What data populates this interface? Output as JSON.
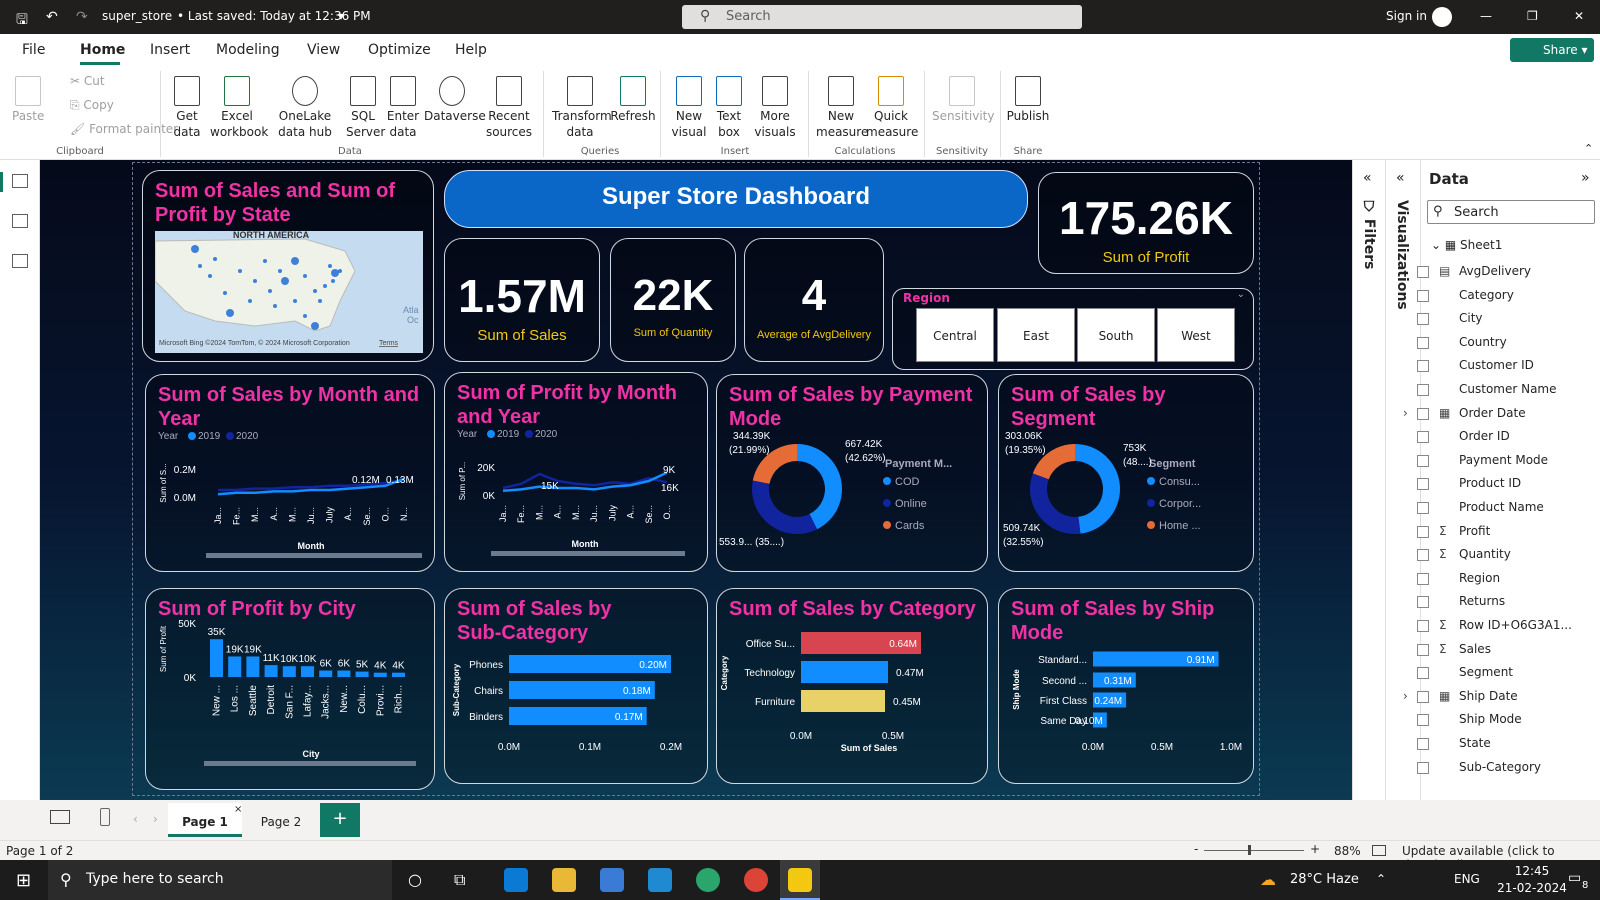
{
  "titlebar": {
    "filename": "super_store",
    "saved": "• Last saved: Today at 12:36 PM",
    "search_placeholder": "Search",
    "signin": "Sign in"
  },
  "menu": {
    "items": [
      "File",
      "Home",
      "Insert",
      "Modeling",
      "View",
      "Optimize",
      "Help"
    ],
    "share": "Share"
  },
  "ribbon": {
    "clipboard": {
      "paste": "Paste",
      "cut": "Cut",
      "copy": "Copy",
      "format_painter": "Format painter",
      "group": "Clipboard"
    },
    "data": {
      "get_data": "Get data",
      "excel": "Excel workbook",
      "onelake": "OneLake data hub",
      "sql": "SQL Server",
      "enter": "Enter data",
      "dataverse": "Dataverse",
      "recent": "Recent sources",
      "group": "Data"
    },
    "queries": {
      "transform": "Transform data",
      "refresh": "Refresh",
      "group": "Queries"
    },
    "insert": {
      "new_visual": "New visual",
      "text_box": "Text box",
      "more_visuals": "More visuals",
      "group": "Insert"
    },
    "calculations": {
      "new_measure": "New measure",
      "quick_measure": "Quick measure",
      "group": "Calculations"
    },
    "sensitivity": {
      "label": "Sensitivity",
      "group": "Sensitivity"
    },
    "share": {
      "publish": "Publish",
      "group": "Share"
    }
  },
  "dashboard": {
    "header": "Super Store Dashboard",
    "map": {
      "title": "Sum of Sales and Sum of Profit by State",
      "region": "NORTH AMERICA",
      "atlantic": "Atla",
      "ocean": "Oc",
      "credit": "Microsoft Bing  ©2024 TomTom, © 2024 Microsoft Corporation",
      "terms": "Terms"
    },
    "kpis": {
      "profit_value": "175.26K",
      "profit_label": "Sum of Profit",
      "sales_value": "1.57M",
      "sales_label": "Sum of Sales",
      "qty_value": "22K",
      "qty_label": "Sum of Quantity",
      "delivery_value": "4",
      "delivery_label": "Average of AvgDelivery"
    },
    "slicer": {
      "title": "Region",
      "options": [
        "Central",
        "East",
        "South",
        "West"
      ]
    },
    "sales_month": {
      "title": "Sum of Sales by Month and Year",
      "legend_title": "Year",
      "legend": [
        "2019",
        "2020"
      ],
      "ylabel": "Sum of S...",
      "xlabel": "Month",
      "yticks": [
        "0.2M",
        "0.0M"
      ],
      "labels": [
        "0.12M",
        "0.13M"
      ],
      "months": [
        "Ja...",
        "Fe...",
        "M...",
        "A...",
        "M...",
        "Ju...",
        "July",
        "A...",
        "Se...",
        "O...",
        "N..."
      ]
    },
    "profit_month": {
      "title": "Sum of Profit by Month and Year",
      "legend_title": "Year",
      "legend": [
        "2019",
        "2020"
      ],
      "ylabel": "Sum of P...",
      "xlabel": "Month",
      "yticks": [
        "20K",
        "0K"
      ],
      "labels": [
        "15K",
        "9K",
        "16K"
      ],
      "months": [
        "Ja...",
        "Fe...",
        "M...",
        "A...",
        "M...",
        "Ju...",
        "July",
        "A...",
        "Se...",
        "O..."
      ]
    },
    "payment": {
      "title": "Sum of Sales by Payment Mode",
      "legend_title": "Payment M...",
      "legend": [
        "COD",
        "Online",
        "Cards"
      ],
      "labels": [
        "344.39K",
        "(21.99%)",
        "667.42K",
        "(42.62%)",
        "553.9... (35....)"
      ]
    },
    "segment": {
      "title": "Sum of Sales by Segment",
      "legend_title": "Segment",
      "legend": [
        "Consu...",
        "Corpor...",
        "Home ..."
      ],
      "labels": [
        "303.06K",
        "(19.35%)",
        "753K",
        "(48....)",
        "509.74K",
        "(32.55%)"
      ]
    },
    "profit_city": {
      "title": "Sum of Profit by City",
      "ylabel": "Sum of Profit",
      "xlabel": "City",
      "yticks": [
        "50K",
        "0K"
      ],
      "cities": [
        "New ...",
        "Los ...",
        "Seattle",
        "Detroit",
        "San F...",
        "Lafay...",
        "Jacks...",
        "New...",
        "Colu...",
        "Provi...",
        "Rich..."
      ],
      "labels": [
        "35K",
        "19K",
        "19K",
        "11K",
        "10K",
        "10K",
        "6K",
        "6K",
        "5K",
        "4K",
        "4K"
      ]
    },
    "subcat": {
      "title": "Sum of Sales by Sub-Category",
      "ylabel": "Sub-Category",
      "cats": [
        "Phones",
        "Chairs",
        "Binders"
      ],
      "labels": [
        "0.20M",
        "0.18M",
        "0.17M"
      ],
      "xticks": [
        "0.0M",
        "0.1M",
        "0.2M"
      ]
    },
    "category": {
      "title": "Sum of Sales by Category",
      "ylabel": "Category",
      "xlabel": "Sum of Sales",
      "cats": [
        "Office Su...",
        "Technology",
        "Furniture"
      ],
      "labels": [
        "0.64M",
        "0.47M",
        "0.45M"
      ],
      "xticks": [
        "0.0M",
        "0.5M"
      ]
    },
    "shipmode": {
      "title": "Sum of Sales by Ship Mode",
      "ylabel": "Ship Mode",
      "cats": [
        "Standard...",
        "Second ...",
        "First Class",
        "Same Day"
      ],
      "labels": [
        "0.91M",
        "0.31M",
        "0.24M",
        "0.10M"
      ],
      "xticks": [
        "0.0M",
        "0.5M",
        "1.0M"
      ]
    }
  },
  "chart_data": [
    {
      "type": "line",
      "title": "Sum of Sales by Month and Year",
      "xlabel": "Month",
      "ylabel": "Sum of S...",
      "series": [
        {
          "name": "2019",
          "values": [
            0.05,
            0.05,
            0.06,
            0.06,
            0.07,
            0.07,
            0.08,
            0.08,
            0.09,
            0.1,
            0.12
          ]
        },
        {
          "name": "2020",
          "values": [
            0.02,
            0.03,
            0.03,
            0.04,
            0.04,
            0.05,
            0.05,
            0.06,
            0.07,
            0.08,
            0.13
          ]
        }
      ]
    },
    {
      "type": "line",
      "title": "Sum of Profit by Month and Year",
      "xlabel": "Month",
      "ylabel": "Sum of P...",
      "series": [
        {
          "name": "2019",
          "values": [
            5,
            8,
            15,
            10,
            8,
            7,
            9,
            8,
            12,
            9
          ]
        },
        {
          "name": "2020",
          "values": [
            3,
            4,
            6,
            5,
            5,
            4,
            6,
            7,
            10,
            16
          ]
        }
      ]
    },
    {
      "type": "pie",
      "title": "Sum of Sales by Payment Mode",
      "categories": [
        "COD",
        "Online",
        "Cards"
      ],
      "values": [
        667.42,
        553.9,
        344.39
      ]
    },
    {
      "type": "pie",
      "title": "Sum of Sales by Segment",
      "categories": [
        "Consu...",
        "Corpor...",
        "Home ..."
      ],
      "values": [
        753,
        509.74,
        303.06
      ]
    },
    {
      "type": "bar",
      "title": "Sum of Profit by City",
      "categories": [
        "New ...",
        "Los ...",
        "Seattle",
        "Detroit",
        "San F...",
        "Lafay...",
        "Jacks...",
        "New...",
        "Colu...",
        "Provi...",
        "Rich..."
      ],
      "values": [
        35,
        19,
        19,
        11,
        10,
        10,
        6,
        6,
        5,
        4,
        4
      ],
      "ylim": [
        0,
        50
      ]
    },
    {
      "type": "bar",
      "title": "Sum of Sales by Sub-Category",
      "categories": [
        "Phones",
        "Chairs",
        "Binders"
      ],
      "values": [
        0.2,
        0.18,
        0.17
      ],
      "xlim": [
        0,
        0.2
      ]
    },
    {
      "type": "bar",
      "title": "Sum of Sales by Category",
      "categories": [
        "Office Su...",
        "Technology",
        "Furniture"
      ],
      "values": [
        0.64,
        0.47,
        0.45
      ],
      "xlim": [
        0,
        0.5
      ]
    },
    {
      "type": "bar",
      "title": "Sum of Sales by Ship Mode",
      "categories": [
        "Standard...",
        "Second ...",
        "First Class",
        "Same Day"
      ],
      "values": [
        0.91,
        0.31,
        0.24,
        0.1
      ],
      "xlim": [
        0,
        1.0
      ]
    }
  ],
  "panes": {
    "filters": "Filters",
    "visualizations": "Visualizations",
    "data_title": "Data",
    "data_search": "Search",
    "table": "Sheet1",
    "fields": [
      "AvgDelivery",
      "Category",
      "City",
      "Country",
      "Customer ID",
      "Customer Name",
      "Order Date",
      "Order ID",
      "Payment Mode",
      "Product ID",
      "Product Name",
      "Profit",
      "Quantity",
      "Region",
      "Returns",
      "Row ID+O6G3A1...",
      "Sales",
      "Segment",
      "Ship Date",
      "Ship Mode",
      "State",
      "Sub-Category"
    ],
    "sigma": [
      "Profit",
      "Quantity",
      "Row ID+O6G3A1...",
      "Sales"
    ],
    "calendar": [
      "Order Date",
      "Ship Date"
    ]
  },
  "pages": {
    "tabs": [
      "Page 1",
      "Page 2"
    ],
    "add": "+"
  },
  "status": {
    "page": "Page 1 of 2",
    "zoom": "88%",
    "update": "Update available (click to download)"
  },
  "taskbar": {
    "search": "Type here to search",
    "weather": "28°C  Haze",
    "lang": "ENG",
    "time": "12:45",
    "date": "21-02-2024",
    "notif": "8"
  },
  "colors": {
    "accent": "#117865",
    "title_pink": "#f032a6",
    "kpi_yellow": "#f2c811",
    "series1": "#118dff",
    "series2": "#12239e",
    "orange": "#e66c37",
    "red": "#d64550",
    "yellow_bar": "#e8d166"
  }
}
